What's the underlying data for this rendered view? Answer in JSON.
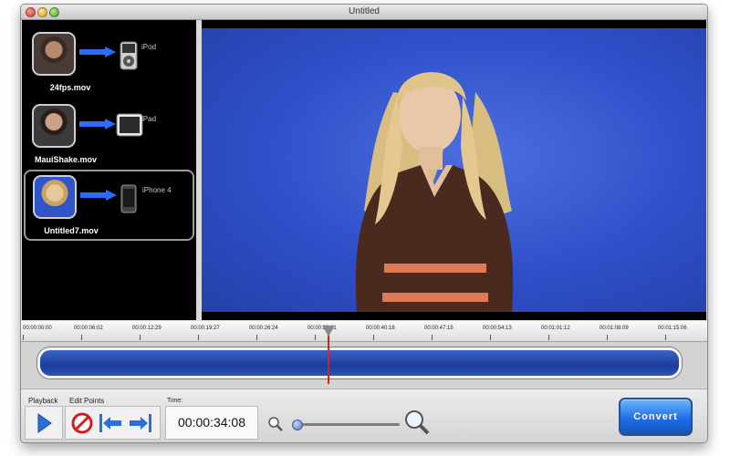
{
  "window": {
    "title": "Untitled"
  },
  "files": [
    {
      "name": "24fps.mov",
      "device": "iPod"
    },
    {
      "name": "MauiShake.mov",
      "device": "iPad"
    },
    {
      "name": "Untitled7.mov",
      "device": "iPhone 4",
      "selected": true
    }
  ],
  "timeline": {
    "ticks": [
      "00:00:00:00",
      "00:00:06:02",
      "00:00:12:29",
      "00:00:19:27",
      "00:00:26:24",
      "00:00:33:21",
      "00:00:40:18",
      "00:00:47:15",
      "00:00:54:13",
      "00:01:01:12",
      "00:01:08:09",
      "00:01:15:06"
    ]
  },
  "controls": {
    "playback_label": "Playback",
    "edit_points_label": "Edit Points",
    "time_label": "Time:",
    "time_value": "00:00:34:08",
    "convert_label": "Convert"
  },
  "colors": {
    "accent": "#1f6ee6",
    "playhead": "#d32222",
    "video_bg": "#2f4fc9"
  }
}
